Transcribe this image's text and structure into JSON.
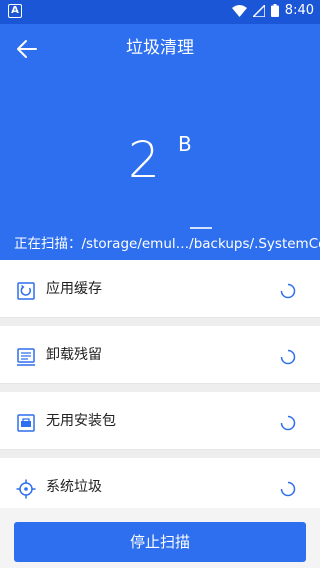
{
  "status_bar": {
    "notification_icon": "A",
    "time": "8:40"
  },
  "header": {
    "title": "垃圾清理",
    "size_value": "2",
    "size_unit": "B",
    "scan_text": "正在扫描：/storage/emul…/backups/.SystemConfig"
  },
  "items": [
    {
      "label": "应用缓存",
      "icon": "cache-icon"
    },
    {
      "label": "卸载残留",
      "icon": "uninstall-residue-icon"
    },
    {
      "label": "无用安装包",
      "icon": "apk-package-icon"
    },
    {
      "label": "系统垃圾",
      "icon": "system-junk-icon"
    }
  ],
  "footer": {
    "stop_label": "停止扫描"
  },
  "colors": {
    "accent": "#2d6fee",
    "status_bar": "#1a56d6"
  }
}
